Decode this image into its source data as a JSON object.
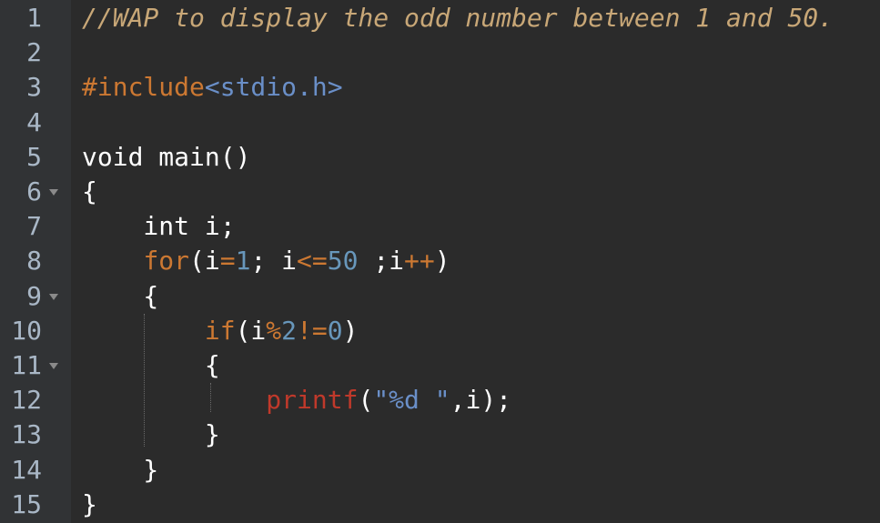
{
  "colors": {
    "background": "#2b2b2b",
    "gutter": "#313335",
    "comment": "#c8a777",
    "preprocessor": "#cc7832",
    "include": "#6a8fc8",
    "keyword": "#cc7832",
    "number": "#6897bb",
    "function": "#c0392b",
    "string": "#6a8fc8"
  },
  "lines": [
    {
      "num": "1",
      "fold": false,
      "tokens": [
        {
          "t": "//WAP to display the odd number between 1 and 50.",
          "c": "comment"
        }
      ]
    },
    {
      "num": "2",
      "fold": false,
      "tokens": []
    },
    {
      "num": "3",
      "fold": false,
      "tokens": [
        {
          "t": "#include",
          "c": "pre"
        },
        {
          "t": "<stdio.h>",
          "c": "inc"
        }
      ]
    },
    {
      "num": "4",
      "fold": false,
      "tokens": []
    },
    {
      "num": "5",
      "fold": false,
      "tokens": [
        {
          "t": "void main()",
          "c": "plain"
        }
      ]
    },
    {
      "num": "6",
      "fold": true,
      "tokens": [
        {
          "t": "{",
          "c": "plain"
        }
      ]
    },
    {
      "num": "7",
      "fold": false,
      "tokens": [
        {
          "t": "    int i;",
          "c": "plain"
        }
      ]
    },
    {
      "num": "8",
      "fold": false,
      "tokens": [
        {
          "t": "    ",
          "c": "plain"
        },
        {
          "t": "for",
          "c": "kw"
        },
        {
          "t": "(i",
          "c": "plain"
        },
        {
          "t": "=",
          "c": "op"
        },
        {
          "t": "1",
          "c": "num"
        },
        {
          "t": "; i",
          "c": "plain"
        },
        {
          "t": "<=",
          "c": "op"
        },
        {
          "t": "50",
          "c": "num"
        },
        {
          "t": " ;i",
          "c": "plain"
        },
        {
          "t": "++",
          "c": "op"
        },
        {
          "t": ")",
          "c": "plain"
        }
      ]
    },
    {
      "num": "9",
      "fold": true,
      "tokens": [
        {
          "t": "    {",
          "c": "plain"
        }
      ]
    },
    {
      "num": "10",
      "fold": false,
      "tokens": [
        {
          "t": "        ",
          "c": "plain"
        },
        {
          "t": "if",
          "c": "kw"
        },
        {
          "t": "(i",
          "c": "plain"
        },
        {
          "t": "%",
          "c": "op"
        },
        {
          "t": "2",
          "c": "num"
        },
        {
          "t": "!=",
          "c": "op"
        },
        {
          "t": "0",
          "c": "num"
        },
        {
          "t": ")",
          "c": "plain"
        }
      ]
    },
    {
      "num": "11",
      "fold": true,
      "tokens": [
        {
          "t": "        {",
          "c": "plain"
        }
      ]
    },
    {
      "num": "12",
      "fold": false,
      "tokens": [
        {
          "t": "            ",
          "c": "plain"
        },
        {
          "t": "printf",
          "c": "func"
        },
        {
          "t": "(",
          "c": "plain"
        },
        {
          "t": "\"%d \"",
          "c": "str"
        },
        {
          "t": ",i);",
          "c": "plain"
        }
      ]
    },
    {
      "num": "13",
      "fold": false,
      "tokens": [
        {
          "t": "        }",
          "c": "plain"
        }
      ]
    },
    {
      "num": "14",
      "fold": false,
      "tokens": [
        {
          "t": "    }",
          "c": "plain"
        }
      ]
    },
    {
      "num": "15",
      "fold": false,
      "tokens": [
        {
          "t": "}",
          "c": "plain"
        }
      ]
    }
  ]
}
